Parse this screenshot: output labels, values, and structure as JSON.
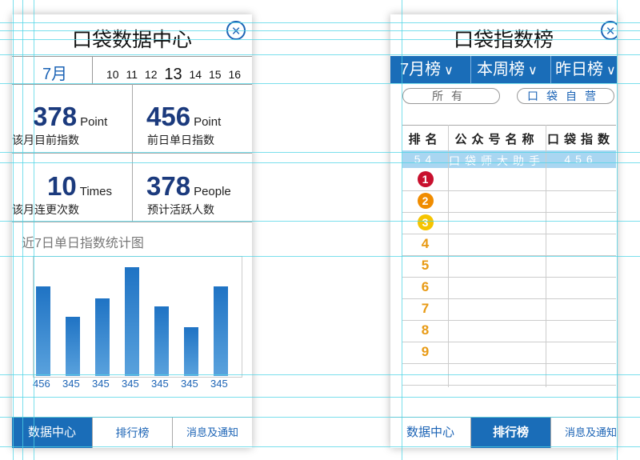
{
  "screen1": {
    "title": "口袋数据中心",
    "close_icon": "close-circle-icon",
    "date_bar": {
      "month": "7月",
      "days": [
        "10",
        "11",
        "12",
        "13",
        "14",
        "15",
        "16"
      ],
      "current_day": "13"
    },
    "stats": [
      {
        "value": "378",
        "unit": "Point",
        "label": "该月目前指数"
      },
      {
        "value": "456",
        "unit": "Point",
        "label": "前日单日指数"
      },
      {
        "value": "10",
        "unit": "Times",
        "label": "该月连更次数"
      },
      {
        "value": "378",
        "unit": "People",
        "label": "预计活跃人数"
      }
    ],
    "chart_title": "近7日单日指数统计图",
    "tabs": [
      {
        "label": "数据中心",
        "active": true
      },
      {
        "label": "排行榜",
        "active": false
      },
      {
        "label": "消息及通知",
        "active": false
      }
    ]
  },
  "chart_data": {
    "type": "bar",
    "title": "近7日单日指数统计图",
    "categories": [
      "",
      "",
      "",
      "",
      "",
      "",
      ""
    ],
    "values": [
      456,
      345,
      345,
      345,
      345,
      345,
      345
    ],
    "data_labels": [
      "456",
      "345",
      "345",
      "345",
      "345",
      "345",
      "345"
    ],
    "bar_color": "#1f73c4"
  },
  "screen2": {
    "title": "口袋指数榜",
    "close_icon": "close-circle-icon",
    "range_tabs": [
      "7月榜",
      "本周榜",
      "昨日榜"
    ],
    "filters": [
      "所有",
      "口袋自营"
    ],
    "table": {
      "headers": [
        "排名",
        "公众号名称",
        "口袋指数"
      ],
      "highlight_row": {
        "rank": "54",
        "name": "口袋师大助手",
        "index": "456"
      },
      "ranks": [
        "1",
        "2",
        "3",
        "4",
        "5",
        "6",
        "7",
        "8",
        "9"
      ]
    },
    "tabs": [
      {
        "label": "数据中心",
        "active": false
      },
      {
        "label": "排行榜",
        "active": true
      },
      {
        "label": "消息及通知",
        "active": false
      }
    ],
    "colors": {
      "brand": "#1a6db8",
      "highlight": "#a9d6f1",
      "rank1": "#c8102e",
      "rank2": "#f08c00",
      "rank3": "#f5c400",
      "rank_other": "#e89a14"
    }
  }
}
